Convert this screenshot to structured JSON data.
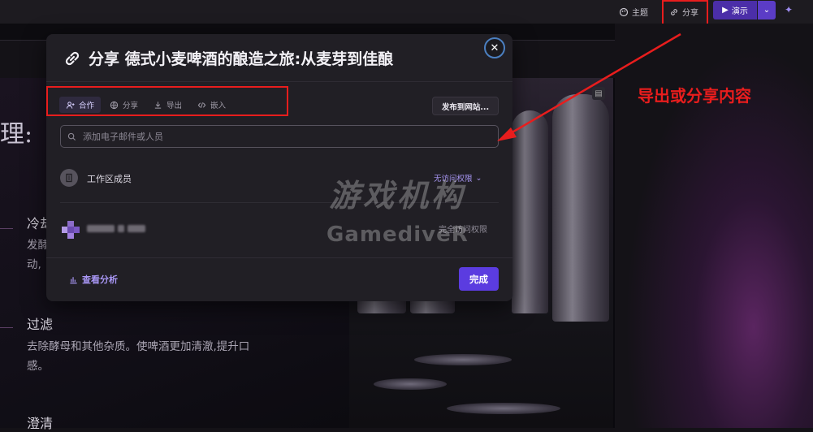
{
  "topbar": {
    "theme_label": "主题",
    "share_label": "分享",
    "present_label": "演示"
  },
  "editor": {
    "heading_fragment": "理:",
    "items": [
      {
        "title": "冷却",
        "desc_line1": "发酵",
        "desc_line2": "动,"
      },
      {
        "title": "过滤",
        "desc_line1": "去除酵母和其他杂质。使啤酒更加清澈,提升口",
        "desc_line2": "感。"
      },
      {
        "title": "澄清"
      }
    ]
  },
  "modal": {
    "title": "分享 德式小麦啤酒的酿造之旅:从麦芽到佳酿",
    "tabs": [
      {
        "label": "合作",
        "icon": "user-plus-icon",
        "active": true
      },
      {
        "label": "分享",
        "icon": "globe-icon",
        "active": false
      },
      {
        "label": "导出",
        "icon": "download-icon",
        "active": false
      },
      {
        "label": "嵌入",
        "icon": "code-icon",
        "active": false
      }
    ],
    "publish_label": "发布到网站...",
    "search_placeholder": "添加电子邮件或人员",
    "workspace_label": "工作区成员",
    "workspace_permission": "无访问权限",
    "user_permission": "完全访问权限",
    "analytics_label": "查看分析",
    "done_label": "完成"
  },
  "watermark": {
    "line1": "游戏机构",
    "line2": "GamediveR"
  },
  "annotation": {
    "text": "导出或分享内容"
  },
  "colors": {
    "accent": "#5b3ce0",
    "annotation_red": "#e81d1d"
  }
}
